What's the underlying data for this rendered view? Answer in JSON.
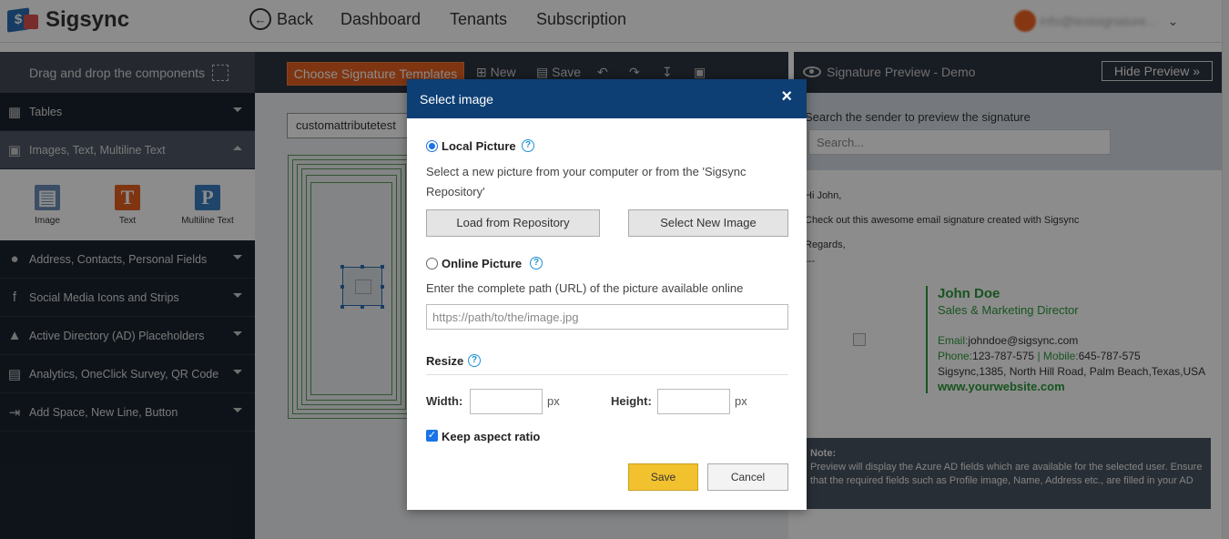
{
  "app": {
    "name": "Sigsync"
  },
  "nav": {
    "back": "Back",
    "links": [
      "Dashboard",
      "Tenants",
      "Subscription"
    ],
    "user_email": "info@testsignature..."
  },
  "sidebar": {
    "header": "Drag and drop the components",
    "items": [
      {
        "label": "Tables",
        "icon": "table-icon"
      },
      {
        "label": "Images, Text, Multiline Text",
        "icon": "image-icon"
      },
      {
        "label": "Address, Contacts, Personal Fields",
        "icon": "user-icon"
      },
      {
        "label": "Social Media Icons and Strips",
        "icon": "facebook-icon"
      },
      {
        "label": "Active Directory (AD) Placeholders",
        "icon": "azure-icon"
      },
      {
        "label": "Analytics, OneClick Survey, QR Code",
        "icon": "analytics-icon"
      },
      {
        "label": "Add Space, New Line, Button",
        "icon": "add-space-icon"
      }
    ],
    "components": [
      {
        "label": "Image",
        "icon": "image-add-icon"
      },
      {
        "label": "Text",
        "icon": "text-icon"
      },
      {
        "label": "Multiline Text",
        "icon": "multiline-text-icon"
      }
    ]
  },
  "toolbar": {
    "choose_templates": "Choose Signature Templates",
    "new": "New",
    "save": "Save"
  },
  "editor": {
    "attribute_value": "customattributetest"
  },
  "preview": {
    "title": "Signature Preview - Demo",
    "hide_button": "Hide Preview »",
    "search_label": "Search the sender to preview the signature",
    "search_placeholder": "Search...",
    "greeting": "Hi John,",
    "body": "Check out this awesome email signature created with Sigsync",
    "regards": "Regards,",
    "dashes": "---",
    "signature": {
      "name": "John Doe",
      "title": "Sales & Marketing Director",
      "email_label": "Email:",
      "email": "johndoe@sigsync.com",
      "phone_label": "Phone:",
      "phone": "123-787-575",
      "separator": "|",
      "mobile_label": "Mobile:",
      "mobile": "645-787-575",
      "address": "Sigsync,1385, North Hill Road, Palm Beach,Texas,USA",
      "website": "www.yourwebsite.com"
    },
    "note_title": "Note:",
    "note_text": "Preview will display the Azure AD fields which are available for the selected user. Ensure that the required fields such as Profile image, Name, Address etc., are filled in your AD"
  },
  "modal": {
    "title": "Select image",
    "close": "×",
    "local_label": "Local Picture",
    "local_desc": "Select a new picture from your computer or from the 'Sigsync Repository'",
    "load_repo": "Load from Repository",
    "select_new": "Select New Image",
    "online_label": "Online Picture",
    "online_desc": "Enter the complete path (URL) of the picture available online",
    "url_placeholder": "https://path/to/the/image.jpg",
    "resize_label": "Resize",
    "width_label": "Width:",
    "height_label": "Height:",
    "unit": "px",
    "keep_aspect": "Keep aspect ratio",
    "save": "Save",
    "cancel": "Cancel",
    "selected_option": "local",
    "keep_aspect_checked": true
  },
  "colors": {
    "brand_orange": "#e8611f",
    "modal_header": "#0d3f74",
    "signature_green": "#2a9a3a",
    "save_yellow": "#f2c12e"
  }
}
